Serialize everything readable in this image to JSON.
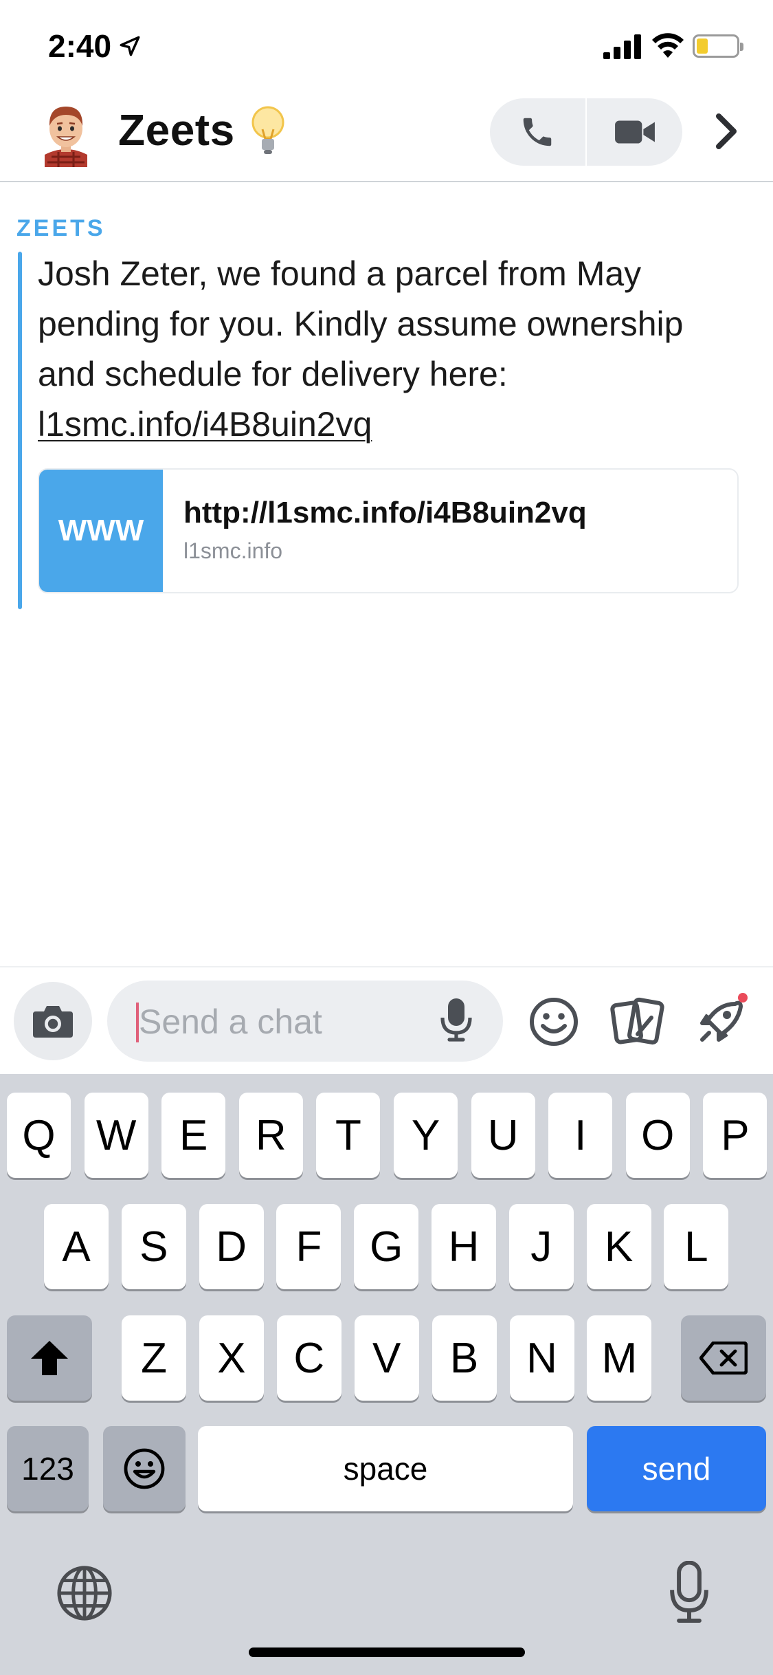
{
  "status_bar": {
    "time": "2:40",
    "icons": [
      "location-arrow-icon",
      "cellular-signal-icon",
      "wifi-icon",
      "battery-low-icon"
    ]
  },
  "header": {
    "title": "Zeets",
    "title_emoji": "💡",
    "icons": [
      "bitmoji-avatar",
      "phone-icon",
      "video-camera-icon",
      "chevron-right-icon"
    ]
  },
  "message": {
    "sender": "ZEETS",
    "text_before_link": "Josh Zeter, we found a parcel from May pending for you. Kindly assume ownership and schedule for delivery here: ",
    "link_text": "l1smc.info/i4B8uin2vq",
    "preview": {
      "thumb_label": "www",
      "url": "http://l1smc.info/i4B8uin2vq",
      "domain": "l1smc.info"
    }
  },
  "composer": {
    "placeholder": "Send a chat",
    "icons": [
      "camera-icon",
      "microphone-icon",
      "bitmoji-smile-icon",
      "stickers-icon",
      "rocket-icon"
    ]
  },
  "keyboard": {
    "row1": [
      "Q",
      "W",
      "E",
      "R",
      "T",
      "Y",
      "U",
      "I",
      "O",
      "P"
    ],
    "row2": [
      "A",
      "S",
      "D",
      "F",
      "G",
      "H",
      "J",
      "K",
      "L"
    ],
    "row3": [
      "Z",
      "X",
      "C",
      "V",
      "B",
      "N",
      "M"
    ],
    "numbers_label": "123",
    "space_label": "space",
    "send_label": "send",
    "accent_color": "#2C79F1"
  },
  "colors": {
    "accent_blue": "#4AA7EA",
    "key_gray": "#ABB0BA",
    "keyboard_bg": "#D2D5DB"
  }
}
